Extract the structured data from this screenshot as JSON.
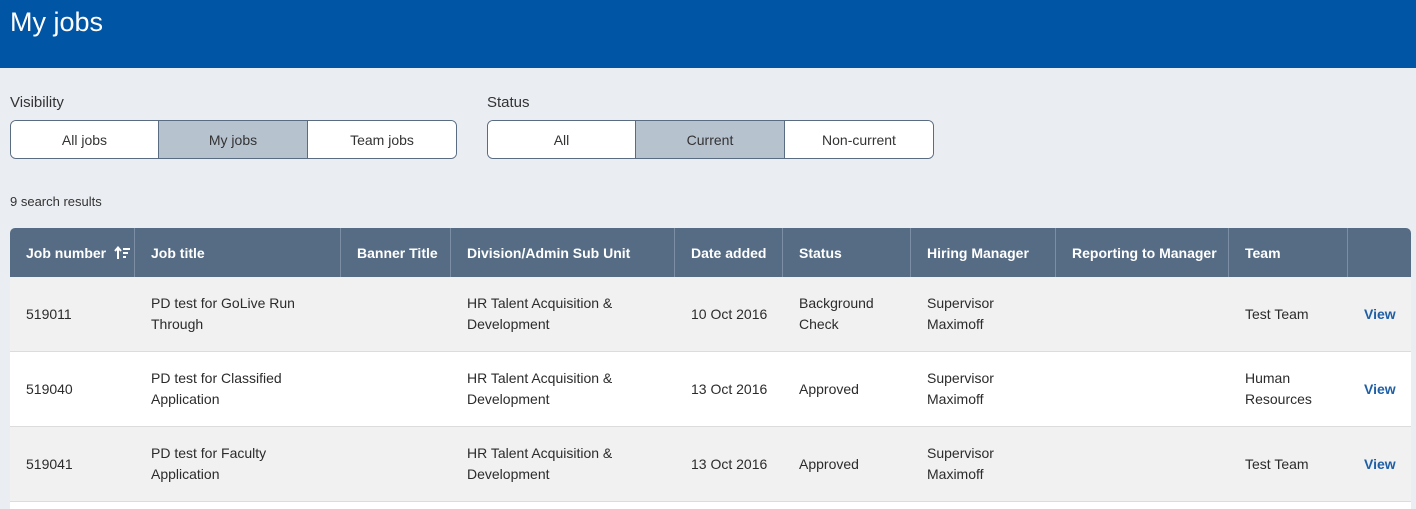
{
  "header": {
    "title": "My jobs"
  },
  "filters": {
    "visibility": {
      "label": "Visibility",
      "options": [
        "All jobs",
        "My jobs",
        "Team jobs"
      ],
      "selected": "My jobs"
    },
    "status": {
      "label": "Status",
      "options": [
        "All",
        "Current",
        "Non-current"
      ],
      "selected": "Current"
    }
  },
  "results": {
    "count_text": "9 search results"
  },
  "table": {
    "columns": [
      "Job number",
      "Job title",
      "Banner Title",
      "Division/Admin Sub Unit",
      "Date added",
      "Status",
      "Hiring Manager",
      "Reporting to Manager",
      "Team",
      ""
    ],
    "sorted_column_icon": "sort-ascending-icon",
    "rows": [
      {
        "job_number": "519011",
        "job_title": "PD test for GoLive Run Through",
        "banner_title": "",
        "division": "HR Talent Acquisition & Development",
        "date_added": "10 Oct 2016",
        "status": "Background Check",
        "hiring_manager": "Supervisor Maximoff",
        "reporting_manager": "",
        "team": "Test Team",
        "action": "View"
      },
      {
        "job_number": "519040",
        "job_title": "PD test for Classified Application",
        "banner_title": "",
        "division": "HR Talent Acquisition & Development",
        "date_added": "13 Oct 2016",
        "status": "Approved",
        "hiring_manager": "Supervisor Maximoff",
        "reporting_manager": "",
        "team": "Human Resources",
        "action": "View"
      },
      {
        "job_number": "519041",
        "job_title": "PD test for Faculty Application",
        "banner_title": "",
        "division": "HR Talent Acquisition & Development",
        "date_added": "13 Oct 2016",
        "status": "Approved",
        "hiring_manager": "Supervisor Maximoff",
        "reporting_manager": "",
        "team": "Test Team",
        "action": "View"
      }
    ]
  },
  "colors": {
    "header_bg": "#0055a5",
    "page_bg": "#eaedf2",
    "table_header_bg": "#566c85",
    "segment_active_bg": "#b7c2cf",
    "link": "#1f5fa6"
  }
}
